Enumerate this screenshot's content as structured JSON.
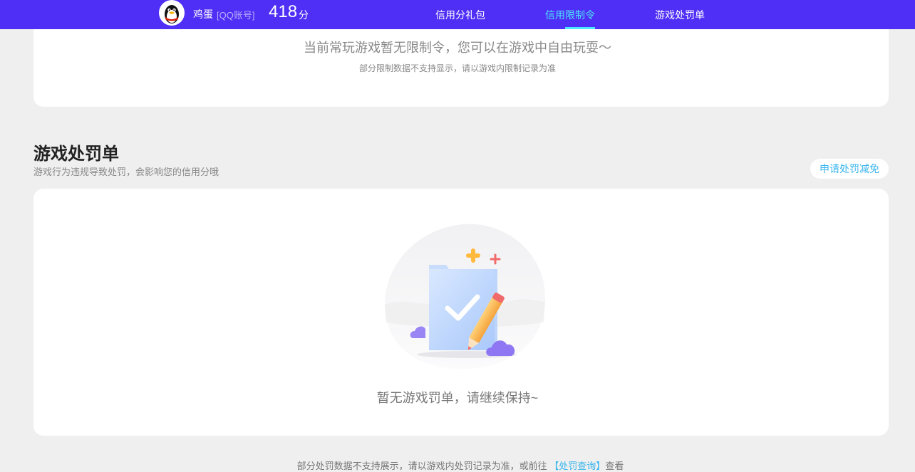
{
  "header": {
    "user_name": "鸡蛋",
    "account_type": "[QQ账号]",
    "credit_score": "418",
    "score_unit": "分",
    "nav": [
      {
        "label": "信用分礼包",
        "active": false
      },
      {
        "label": "信用限制令",
        "active": true
      },
      {
        "label": "游戏处罚单",
        "active": false
      }
    ]
  },
  "restriction": {
    "message": "当前常玩游戏暂无限制令，您可以在游戏中自由玩耍～",
    "note": "部分限制数据不支持显示，请以游戏内限制记录为准"
  },
  "penalty": {
    "title": "游戏处罚单",
    "subtitle": "游戏行为违规导致处罚，会影响您的信用分哦",
    "appeal_button": "申请处罚减免",
    "empty_message": "暂无游戏罚单，请继续保持~"
  },
  "footer": {
    "note_prefix": "部分处罚数据不支持展示，请以游戏内处罚记录为准，或前往",
    "link": "【处罚查询】",
    "note_suffix": "查看"
  },
  "colors": {
    "header_bg": "#4f2ff5",
    "active_nav": "#4de7ff",
    "link": "#37b5ee",
    "page_bg": "#efefef"
  }
}
